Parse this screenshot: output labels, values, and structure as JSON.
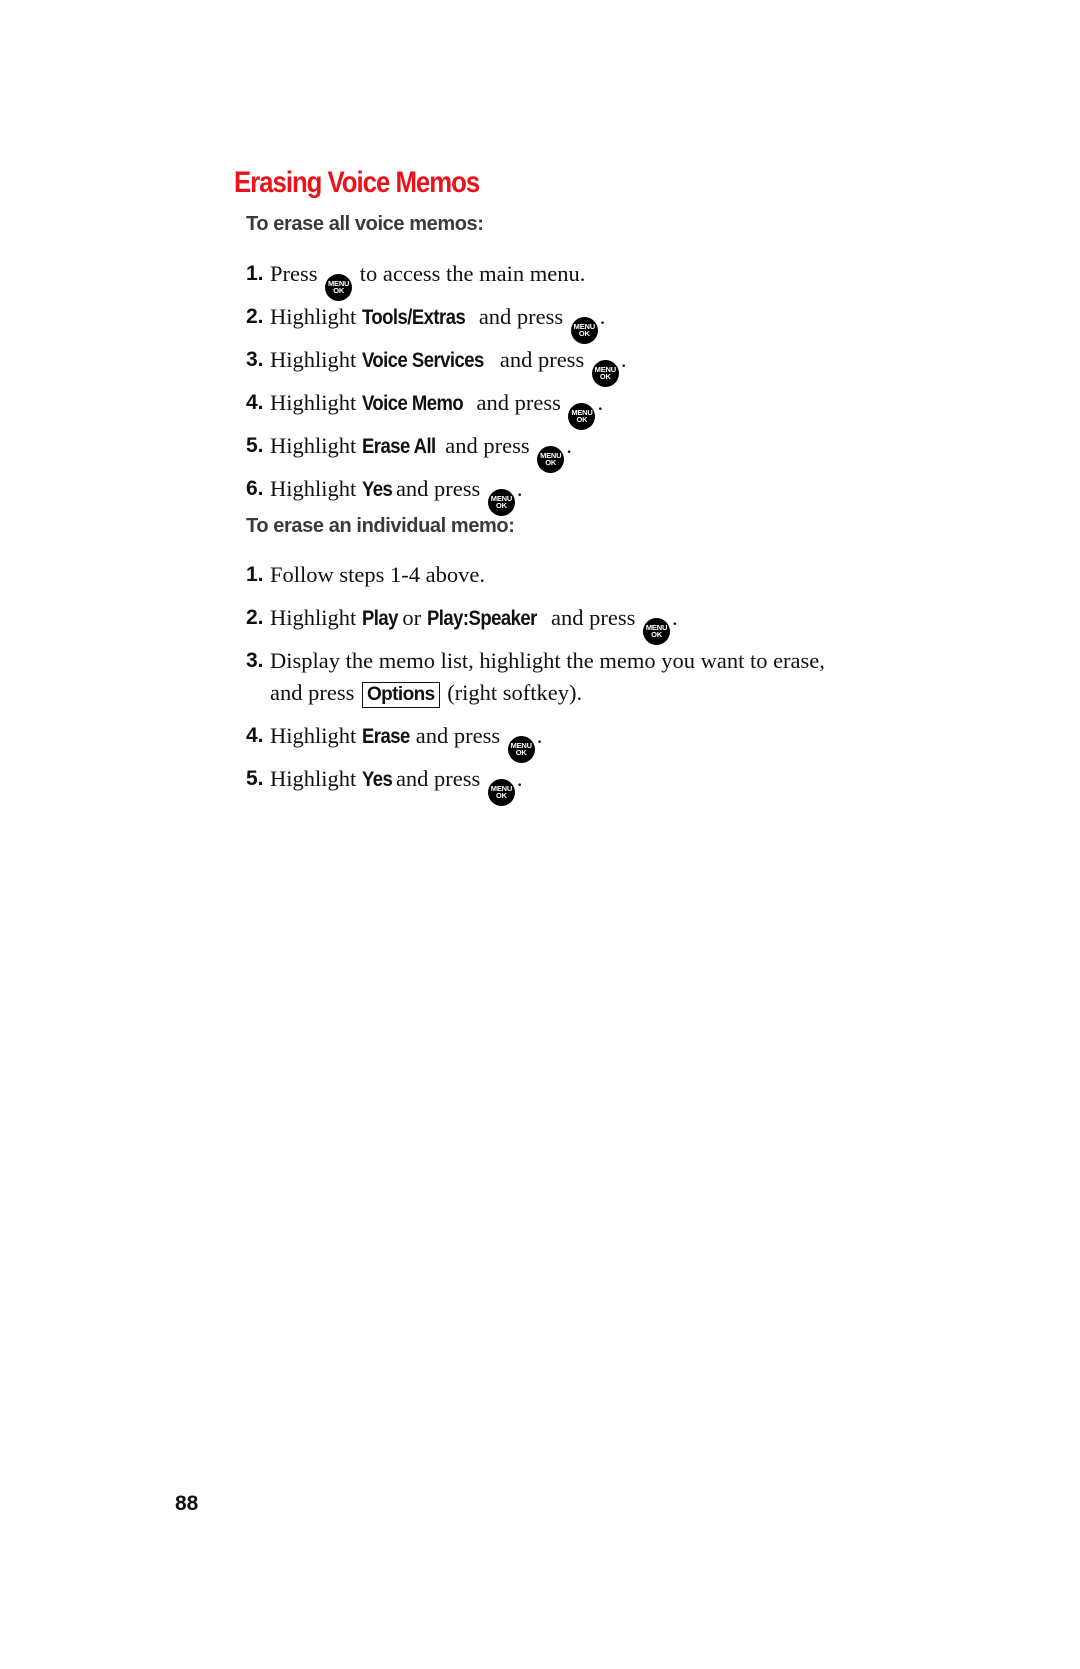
{
  "title": "Erasing Voice Memos",
  "colors": {
    "title": "#e8141c",
    "text": "#111111",
    "subhead": "#3a3a3a"
  },
  "icons": {
    "menu_ok": {
      "name": "menu-ok-key-icon",
      "line1": "MENU",
      "line2": "OK"
    }
  },
  "sections": [
    {
      "heading": "To erase all voice memos:",
      "steps": [
        {
          "num": "1.",
          "pre": "Press",
          "kw": "",
          "mid": "",
          "kw2": "",
          "post": "to access the main menu."
        },
        {
          "num": "2.",
          "pre": "Highlight",
          "kw": "Tools/Extras",
          "post": "and press",
          "end": "."
        },
        {
          "num": "3.",
          "pre": "Highlight",
          "kw": "Voice Services",
          "post": "and press",
          "end": "."
        },
        {
          "num": "4.",
          "pre": "Highlight",
          "kw": "Voice Memo",
          "post": "and press",
          "end": "."
        },
        {
          "num": "5.",
          "pre": "Highlight",
          "kw": "Erase All",
          "post": "and press",
          "end": "."
        },
        {
          "num": "6.",
          "pre": "Highlight",
          "kw": "Yes",
          "post": "and press",
          "end": "."
        }
      ]
    },
    {
      "heading": "To erase an individual memo:",
      "steps": [
        {
          "num": "1.",
          "text": "Follow steps 1-4 above."
        },
        {
          "num": "2.",
          "pre": "Highlight",
          "kw": "Play",
          "mid": "or",
          "kw2": "Play:Speaker",
          "post": "and press",
          "end": "."
        },
        {
          "num": "3.",
          "line1": "Display the memo list, highlight the memo you want to erase,",
          "pre2": "and press",
          "softkey": "Options",
          "post2": "(right softkey)."
        },
        {
          "num": "4.",
          "pre": "Highlight",
          "kw": "Erase",
          "post": "and press",
          "end": "."
        },
        {
          "num": "5.",
          "pre": "Highlight",
          "kw": "Yes",
          "post": "and press",
          "end": "."
        }
      ]
    }
  ],
  "page_number": "88"
}
